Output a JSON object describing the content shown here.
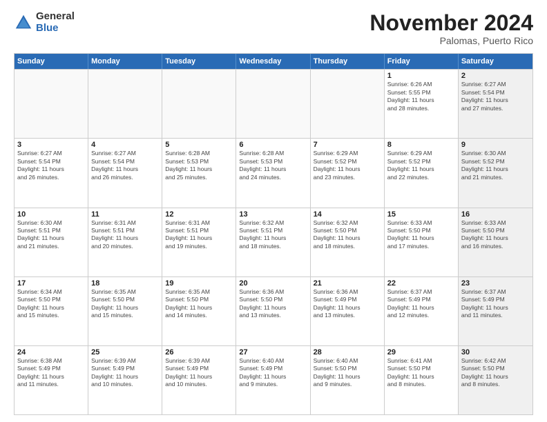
{
  "logo": {
    "general": "General",
    "blue": "Blue"
  },
  "header": {
    "month": "November 2024",
    "location": "Palomas, Puerto Rico"
  },
  "days": [
    "Sunday",
    "Monday",
    "Tuesday",
    "Wednesday",
    "Thursday",
    "Friday",
    "Saturday"
  ],
  "weeks": [
    [
      {
        "day": "",
        "info": "",
        "empty": true
      },
      {
        "day": "",
        "info": "",
        "empty": true
      },
      {
        "day": "",
        "info": "",
        "empty": true
      },
      {
        "day": "",
        "info": "",
        "empty": true
      },
      {
        "day": "",
        "info": "",
        "empty": true
      },
      {
        "day": "1",
        "info": "Sunrise: 6:26 AM\nSunset: 5:55 PM\nDaylight: 11 hours\nand 28 minutes.",
        "empty": false,
        "shaded": false
      },
      {
        "day": "2",
        "info": "Sunrise: 6:27 AM\nSunset: 5:54 PM\nDaylight: 11 hours\nand 27 minutes.",
        "empty": false,
        "shaded": true
      }
    ],
    [
      {
        "day": "3",
        "info": "Sunrise: 6:27 AM\nSunset: 5:54 PM\nDaylight: 11 hours\nand 26 minutes.",
        "empty": false,
        "shaded": false
      },
      {
        "day": "4",
        "info": "Sunrise: 6:27 AM\nSunset: 5:54 PM\nDaylight: 11 hours\nand 26 minutes.",
        "empty": false,
        "shaded": false
      },
      {
        "day": "5",
        "info": "Sunrise: 6:28 AM\nSunset: 5:53 PM\nDaylight: 11 hours\nand 25 minutes.",
        "empty": false,
        "shaded": false
      },
      {
        "day": "6",
        "info": "Sunrise: 6:28 AM\nSunset: 5:53 PM\nDaylight: 11 hours\nand 24 minutes.",
        "empty": false,
        "shaded": false
      },
      {
        "day": "7",
        "info": "Sunrise: 6:29 AM\nSunset: 5:52 PM\nDaylight: 11 hours\nand 23 minutes.",
        "empty": false,
        "shaded": false
      },
      {
        "day": "8",
        "info": "Sunrise: 6:29 AM\nSunset: 5:52 PM\nDaylight: 11 hours\nand 22 minutes.",
        "empty": false,
        "shaded": false
      },
      {
        "day": "9",
        "info": "Sunrise: 6:30 AM\nSunset: 5:52 PM\nDaylight: 11 hours\nand 21 minutes.",
        "empty": false,
        "shaded": true
      }
    ],
    [
      {
        "day": "10",
        "info": "Sunrise: 6:30 AM\nSunset: 5:51 PM\nDaylight: 11 hours\nand 21 minutes.",
        "empty": false,
        "shaded": false
      },
      {
        "day": "11",
        "info": "Sunrise: 6:31 AM\nSunset: 5:51 PM\nDaylight: 11 hours\nand 20 minutes.",
        "empty": false,
        "shaded": false
      },
      {
        "day": "12",
        "info": "Sunrise: 6:31 AM\nSunset: 5:51 PM\nDaylight: 11 hours\nand 19 minutes.",
        "empty": false,
        "shaded": false
      },
      {
        "day": "13",
        "info": "Sunrise: 6:32 AM\nSunset: 5:51 PM\nDaylight: 11 hours\nand 18 minutes.",
        "empty": false,
        "shaded": false
      },
      {
        "day": "14",
        "info": "Sunrise: 6:32 AM\nSunset: 5:50 PM\nDaylight: 11 hours\nand 18 minutes.",
        "empty": false,
        "shaded": false
      },
      {
        "day": "15",
        "info": "Sunrise: 6:33 AM\nSunset: 5:50 PM\nDaylight: 11 hours\nand 17 minutes.",
        "empty": false,
        "shaded": false
      },
      {
        "day": "16",
        "info": "Sunrise: 6:33 AM\nSunset: 5:50 PM\nDaylight: 11 hours\nand 16 minutes.",
        "empty": false,
        "shaded": true
      }
    ],
    [
      {
        "day": "17",
        "info": "Sunrise: 6:34 AM\nSunset: 5:50 PM\nDaylight: 11 hours\nand 15 minutes.",
        "empty": false,
        "shaded": false
      },
      {
        "day": "18",
        "info": "Sunrise: 6:35 AM\nSunset: 5:50 PM\nDaylight: 11 hours\nand 15 minutes.",
        "empty": false,
        "shaded": false
      },
      {
        "day": "19",
        "info": "Sunrise: 6:35 AM\nSunset: 5:50 PM\nDaylight: 11 hours\nand 14 minutes.",
        "empty": false,
        "shaded": false
      },
      {
        "day": "20",
        "info": "Sunrise: 6:36 AM\nSunset: 5:50 PM\nDaylight: 11 hours\nand 13 minutes.",
        "empty": false,
        "shaded": false
      },
      {
        "day": "21",
        "info": "Sunrise: 6:36 AM\nSunset: 5:49 PM\nDaylight: 11 hours\nand 13 minutes.",
        "empty": false,
        "shaded": false
      },
      {
        "day": "22",
        "info": "Sunrise: 6:37 AM\nSunset: 5:49 PM\nDaylight: 11 hours\nand 12 minutes.",
        "empty": false,
        "shaded": false
      },
      {
        "day": "23",
        "info": "Sunrise: 6:37 AM\nSunset: 5:49 PM\nDaylight: 11 hours\nand 11 minutes.",
        "empty": false,
        "shaded": true
      }
    ],
    [
      {
        "day": "24",
        "info": "Sunrise: 6:38 AM\nSunset: 5:49 PM\nDaylight: 11 hours\nand 11 minutes.",
        "empty": false,
        "shaded": false
      },
      {
        "day": "25",
        "info": "Sunrise: 6:39 AM\nSunset: 5:49 PM\nDaylight: 11 hours\nand 10 minutes.",
        "empty": false,
        "shaded": false
      },
      {
        "day": "26",
        "info": "Sunrise: 6:39 AM\nSunset: 5:49 PM\nDaylight: 11 hours\nand 10 minutes.",
        "empty": false,
        "shaded": false
      },
      {
        "day": "27",
        "info": "Sunrise: 6:40 AM\nSunset: 5:49 PM\nDaylight: 11 hours\nand 9 minutes.",
        "empty": false,
        "shaded": false
      },
      {
        "day": "28",
        "info": "Sunrise: 6:40 AM\nSunset: 5:50 PM\nDaylight: 11 hours\nand 9 minutes.",
        "empty": false,
        "shaded": false
      },
      {
        "day": "29",
        "info": "Sunrise: 6:41 AM\nSunset: 5:50 PM\nDaylight: 11 hours\nand 8 minutes.",
        "empty": false,
        "shaded": false
      },
      {
        "day": "30",
        "info": "Sunrise: 6:42 AM\nSunset: 5:50 PM\nDaylight: 11 hours\nand 8 minutes.",
        "empty": false,
        "shaded": true
      }
    ]
  ]
}
